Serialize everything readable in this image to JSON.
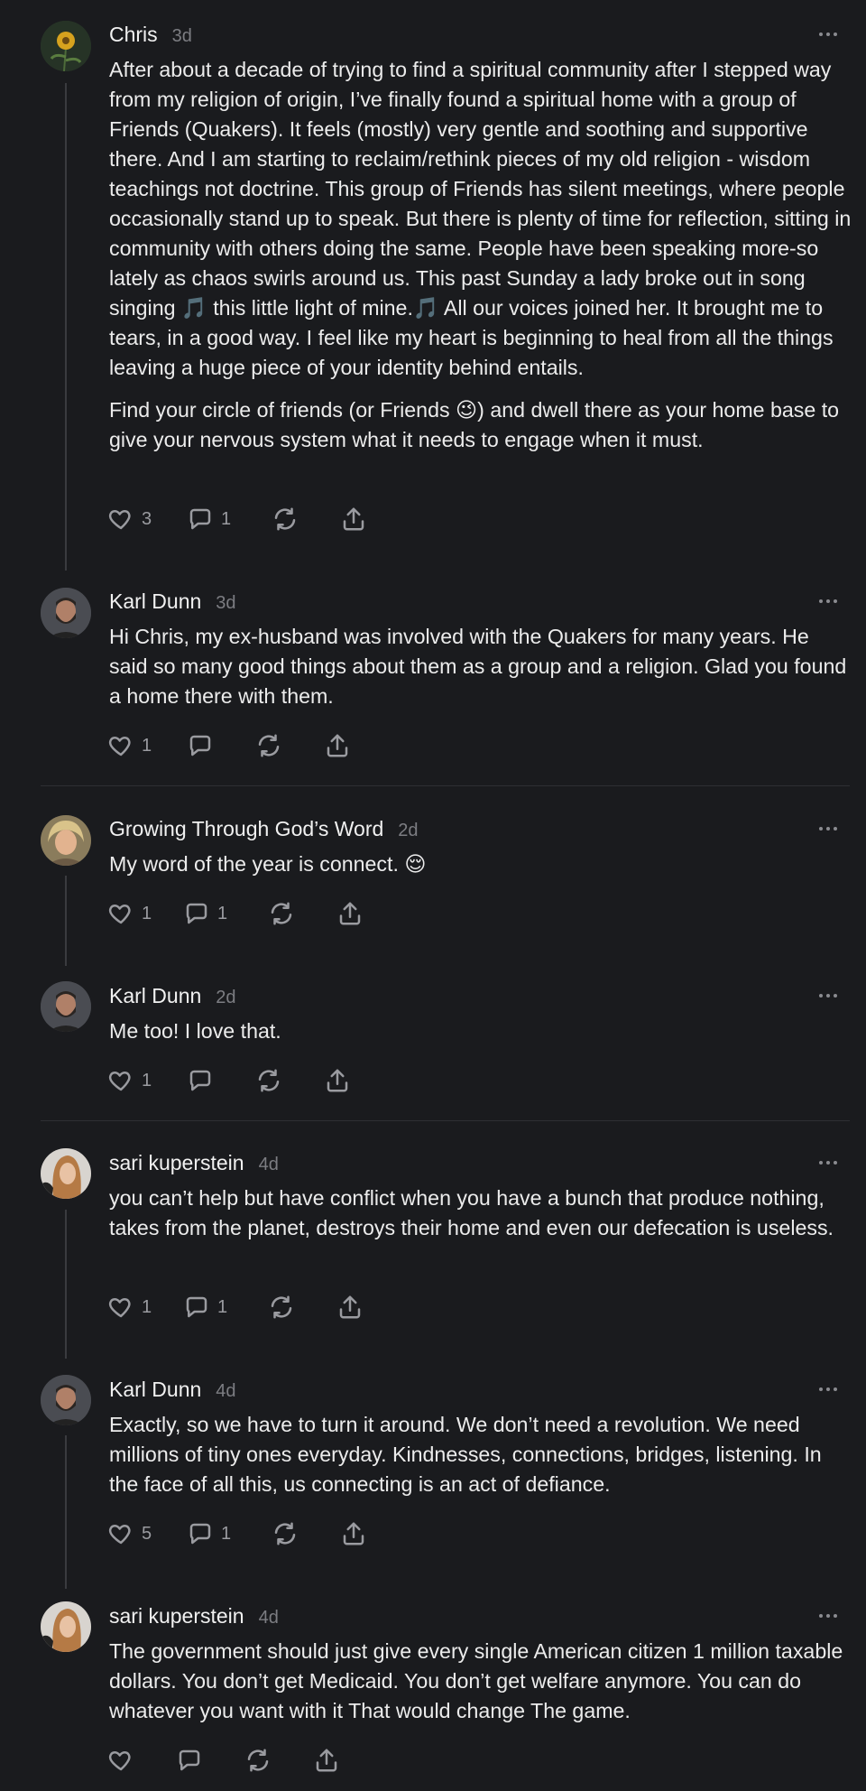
{
  "comments": [
    {
      "author": "Chris",
      "time": "3d",
      "paragraphs": [
        "After about a decade of trying to find a spiritual community after I stepped way from my religion of origin, I’ve finally found a spiritual home with a group of Friends (Quakers). It feels (mostly) very gentle and soothing and supportive there. And I am starting to reclaim/rethink pieces of my old religion - wisdom teachings not doctrine. This group of Friends has silent meetings, where people occasionally stand up to speak. But there is plenty of time for reflection, sitting in community with others doing the same. People have been speaking more-so lately as chaos swirls around us. This past Sunday a lady broke out in song singing 🎵 this little light of mine.🎵 All our voices joined her. It brought me to tears, in a good way. I feel like my heart is beginning to heal from all the things leaving a huge piece of your identity behind entails.",
        "Find your circle of friends (or Friends 😉) and dwell there as your home base to give your nervous system what it needs to engage when it must."
      ],
      "likes": "3",
      "replies": "1"
    },
    {
      "author": "Karl Dunn",
      "time": "3d",
      "paragraphs": [
        "Hi Chris, my ex-husband was involved with the Quakers for many years. He said so many good things about them as a group and a religion. Glad you found a home there with them."
      ],
      "likes": "1",
      "replies": ""
    },
    {
      "author": "Growing Through God’s Word",
      "time": "2d",
      "paragraphs": [
        "My word of the year is connect. 😌"
      ],
      "likes": "1",
      "replies": "1"
    },
    {
      "author": "Karl Dunn",
      "time": "2d",
      "paragraphs": [
        "Me too! I love that."
      ],
      "likes": "1",
      "replies": ""
    },
    {
      "author": "sari kuperstein",
      "time": "4d",
      "paragraphs": [
        "you can’t help but have conflict when you have a bunch that produce nothing, takes from the planet, destroys their home and even our defecation is useless."
      ],
      "likes": "1",
      "replies": "1"
    },
    {
      "author": "Karl Dunn",
      "time": "4d",
      "paragraphs": [
        "Exactly, so we have to turn it around. We don’t need a revolution. We need millions of tiny ones everyday. Kindnesses, connections, bridges, listening. In the face of all this, us connecting is an act of defiance."
      ],
      "likes": "5",
      "replies": "1"
    },
    {
      "author": "sari kuperstein",
      "time": "4d",
      "paragraphs": [
        "The government should just give every single American citizen 1 million taxable dollars. You don’t get Medicaid. You don’t get welfare anymore. You can do whatever you want with it That would change The game."
      ],
      "likes": "",
      "replies": ""
    }
  ],
  "icons": {
    "like": "heart-icon",
    "reply": "comment-icon",
    "restack": "restack-icon",
    "share": "share-icon",
    "more": "more-icon"
  },
  "colors": {
    "background": "#1a1b1e",
    "text": "#ececec",
    "muted": "#7c7d82"
  }
}
